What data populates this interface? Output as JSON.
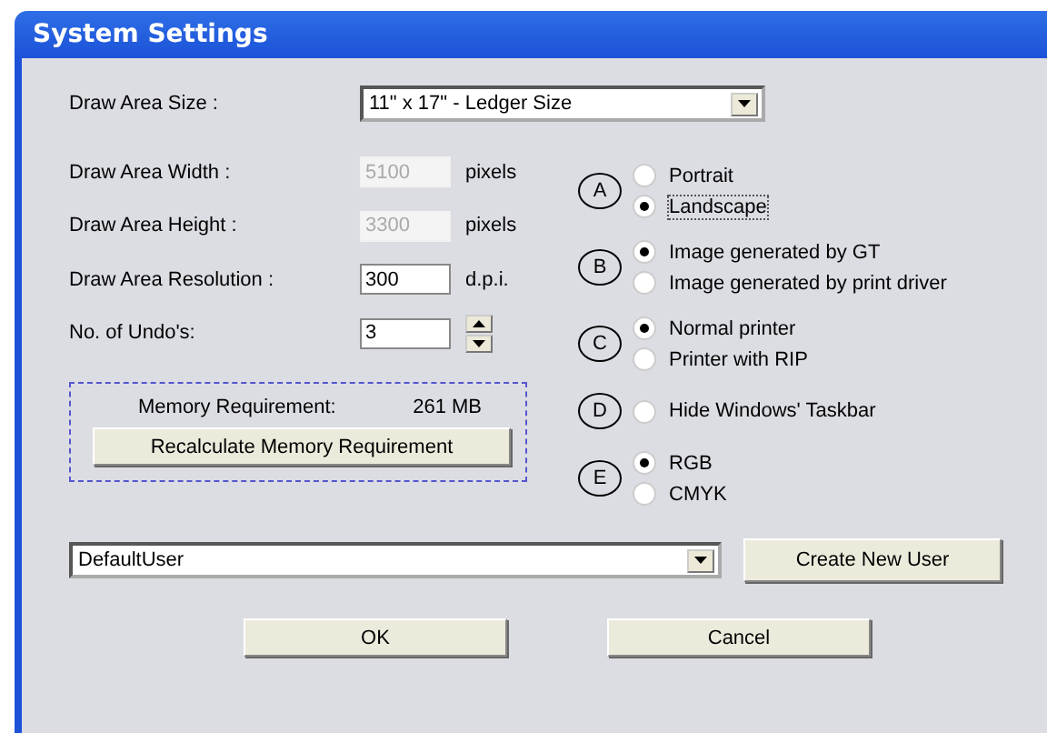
{
  "window": {
    "title": "System Settings"
  },
  "size_field": {
    "label": "Draw Area Size :",
    "value": "11\" x 17\" - Ledger Size"
  },
  "fields": [
    {
      "label": "Draw Area Width :",
      "value": "5100",
      "unit": "pixels",
      "disabled": true,
      "kind": "text"
    },
    {
      "label": "Draw Area Height :",
      "value": "3300",
      "unit": "pixels",
      "disabled": true,
      "kind": "text"
    },
    {
      "label": "Draw Area Resolution :",
      "value": "300",
      "unit": "d.p.i.",
      "disabled": false,
      "kind": "text"
    },
    {
      "label": "No. of Undo's:",
      "value": "3",
      "disabled": false,
      "kind": "spinner"
    }
  ],
  "memory": {
    "label": "Memory Requirement:",
    "value": "261 MB",
    "button": "Recalculate Memory Requirement"
  },
  "radio_groups": [
    {
      "letter": "A",
      "options": [
        {
          "label": "Portrait",
          "selected": false,
          "focused": false
        },
        {
          "label": "Landscape",
          "selected": true,
          "focused": true
        }
      ]
    },
    {
      "letter": "B",
      "options": [
        {
          "label": "Image generated by GT",
          "selected": true,
          "focused": false
        },
        {
          "label": "Image generated by print driver",
          "selected": false,
          "focused": false
        }
      ]
    },
    {
      "letter": "C",
      "options": [
        {
          "label": "Normal printer",
          "selected": true,
          "focused": false
        },
        {
          "label": "Printer with RIP",
          "selected": false,
          "focused": false
        }
      ]
    },
    {
      "letter": "D",
      "options": [
        {
          "label": "Hide Windows' Taskbar",
          "selected": false,
          "focused": false
        }
      ]
    },
    {
      "letter": "E",
      "options": [
        {
          "label": "RGB",
          "selected": true,
          "focused": false
        },
        {
          "label": "CMYK",
          "selected": false,
          "focused": false
        }
      ]
    }
  ],
  "user": {
    "value": "DefaultUser",
    "button": "Create New User"
  },
  "buttons": [
    "OK",
    "Cancel"
  ]
}
